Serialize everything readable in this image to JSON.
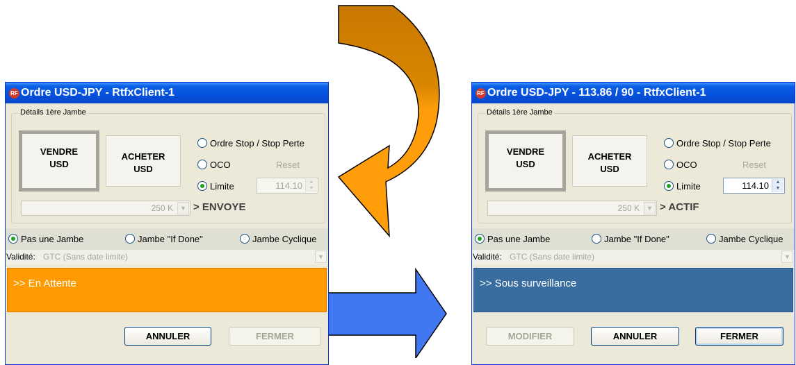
{
  "colors": {
    "title_bar": "#0550dc",
    "pending": "#ff9a01",
    "monitoring": "#3a6d9f",
    "curved_arrow_top": "#c87800",
    "curved_arrow_bottom": "#ff9e0a",
    "right_arrow": "#3f78f0"
  },
  "left_window": {
    "app_icon": "RF",
    "title": "Ordre USD-JPY - RtfxClient-1",
    "group_label": "Détails 1ère Jambe",
    "sell_button": {
      "line1": "VENDRE",
      "line2": "USD"
    },
    "buy_button": {
      "line1": "ACHETER",
      "line2": "USD"
    },
    "order_types": [
      {
        "label": "Ordre Stop / Stop Perte",
        "selected": false
      },
      {
        "label": "OCO",
        "selected": false
      },
      {
        "label": "Limite",
        "selected": true
      }
    ],
    "reset_label": "Reset",
    "limit_value": "114.10",
    "amount": "250 K",
    "status_text": "> ENVOYE",
    "legs": [
      {
        "label": "Pas une Jambe",
        "selected": true
      },
      {
        "label": "Jambe \"If Done\"",
        "selected": false
      },
      {
        "label": "Jambe Cyclique",
        "selected": false
      }
    ],
    "validity_label": "Validité:",
    "validity_value": "GTC (Sans date limite)",
    "message": ">> En Attente",
    "buttons": {
      "annuler": "ANNULER",
      "fermer": "FERMER"
    }
  },
  "right_window": {
    "app_icon": "RF",
    "title": "Ordre USD-JPY - 113.86 / 90 - RtfxClient-1",
    "group_label": "Détails 1ère Jambe",
    "sell_button": {
      "line1": "VENDRE",
      "line2": "USD"
    },
    "buy_button": {
      "line1": "ACHETER",
      "line2": "USD"
    },
    "order_types": [
      {
        "label": "Ordre Stop / Stop Perte",
        "selected": false
      },
      {
        "label": "OCO",
        "selected": false
      },
      {
        "label": "Limite",
        "selected": true
      }
    ],
    "reset_label": "Reset",
    "limit_value": "114.10",
    "amount": "250 K",
    "status_text": "> ACTIF",
    "legs": [
      {
        "label": "Pas une Jambe",
        "selected": true
      },
      {
        "label": "Jambe \"If Done\"",
        "selected": false
      },
      {
        "label": "Jambe Cyclique",
        "selected": false
      }
    ],
    "validity_label": "Validité:",
    "validity_value": "GTC (Sans date limite)",
    "message": ">> Sous surveillance",
    "buttons": {
      "modifier": "MODIFIER",
      "annuler": "ANNULER",
      "fermer": "FERMER"
    }
  }
}
